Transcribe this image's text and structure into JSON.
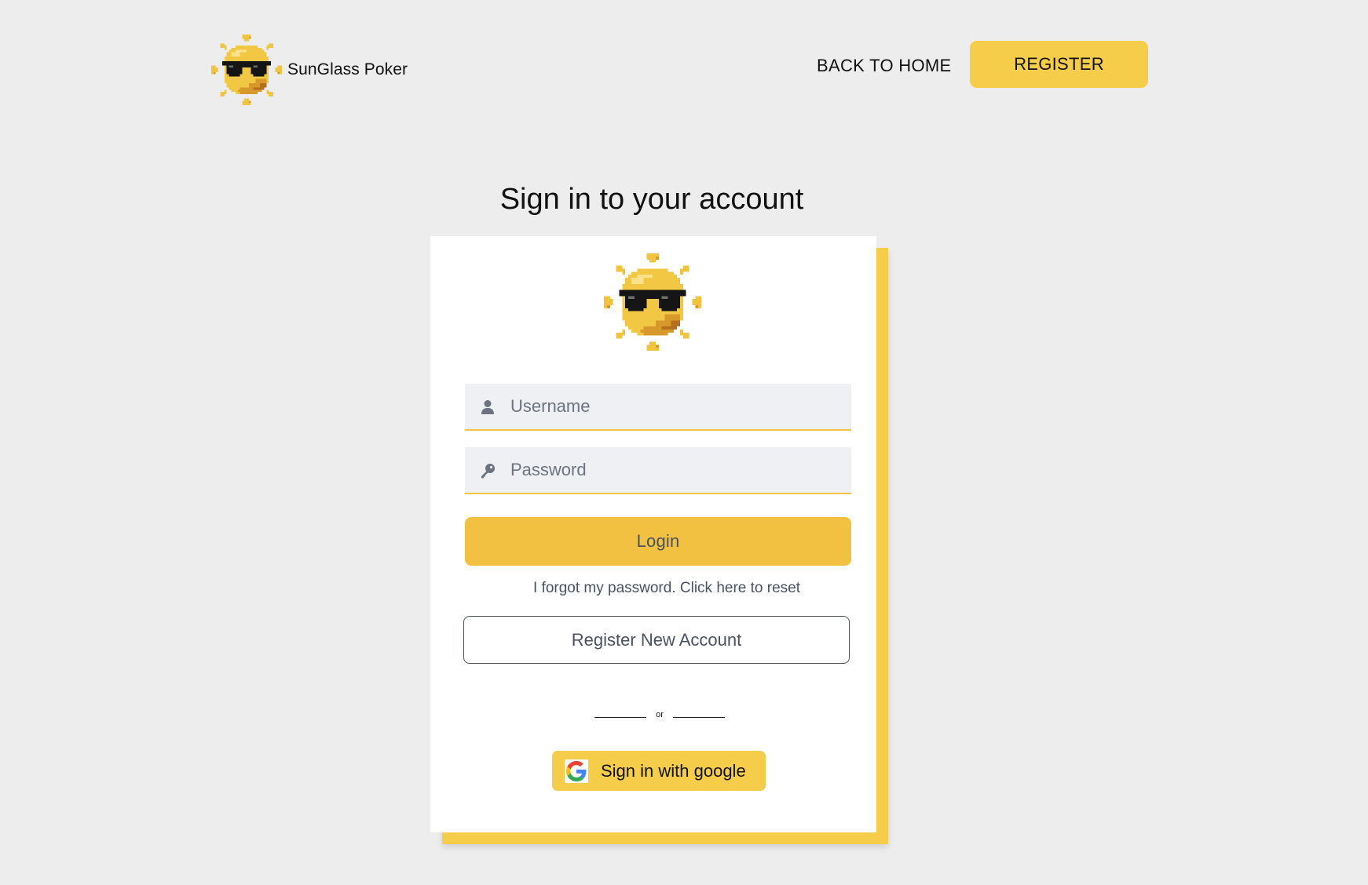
{
  "header": {
    "brand_name": "SunGlass Poker",
    "nav": {
      "back_to_home": "BACK TO HOME",
      "register": "REGISTER"
    }
  },
  "title": "Sign in to your account",
  "form": {
    "username": {
      "placeholder": "Username",
      "value": "",
      "icon": "user-icon"
    },
    "password": {
      "placeholder": "Password",
      "value": "",
      "icon": "key-icon"
    },
    "login_label": "Login",
    "forgot_link": "I forgot my password. Click here to reset",
    "register_new_label": "Register New Account",
    "divider_text": "or",
    "google_label": "Sign in with google"
  },
  "colors": {
    "accent": "#f5cd4a",
    "login_button": "#f3c142",
    "background": "#ededed",
    "input_background": "#eef0f3",
    "muted_text": "#4a5262"
  },
  "icons": {
    "logo": "sunglasses-sun-logo",
    "google": "google-g-icon"
  }
}
